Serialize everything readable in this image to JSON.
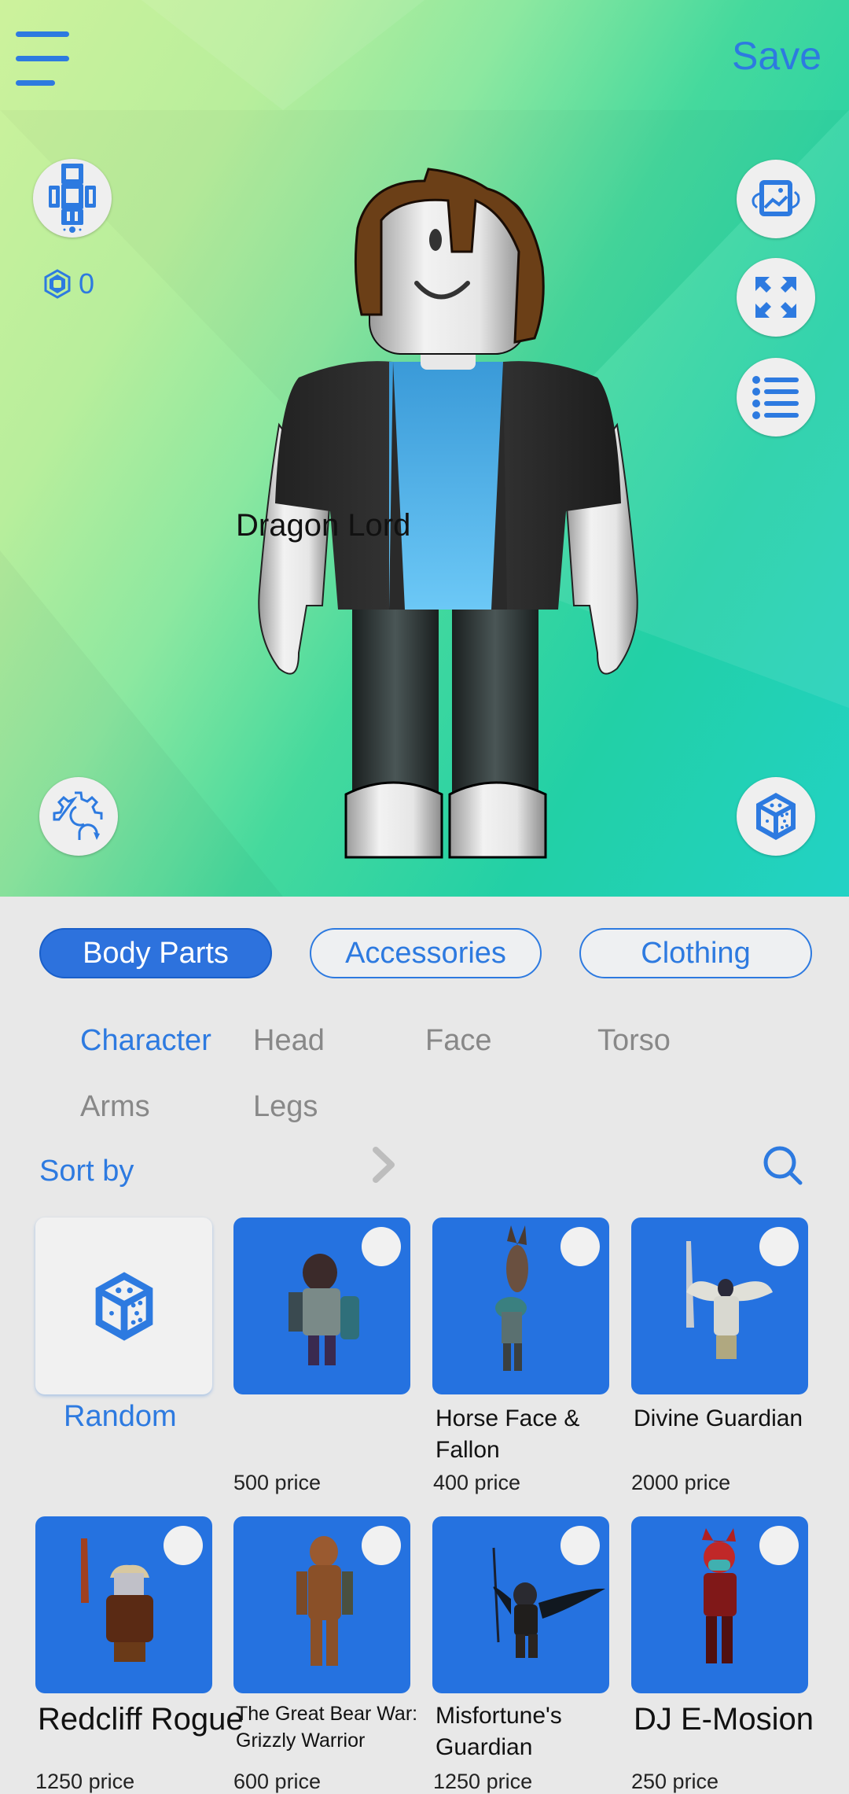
{
  "header": {
    "save_label": "Save"
  },
  "currency": {
    "amount": "0",
    "icon": "robux-icon"
  },
  "viewport_buttons": {
    "left": [
      "avatar-body-icon",
      "settings-refresh-icon"
    ],
    "right": [
      "rotate-image-icon",
      "fullscreen-icon",
      "list-icon",
      "dice-icon"
    ]
  },
  "colors": {
    "accent": "#2d7ae0",
    "card_bg": "#2572e0",
    "panel_bg": "#e8e8e8"
  },
  "tabs": [
    {
      "label": "Body Parts",
      "active": true
    },
    {
      "label": "Accessories",
      "active": false
    },
    {
      "label": "Clothing",
      "active": false
    }
  ],
  "subcategories": [
    {
      "label": "Character",
      "active": true
    },
    {
      "label": "Head",
      "active": false
    },
    {
      "label": "Face",
      "active": false
    },
    {
      "label": "Torso",
      "active": false
    },
    {
      "label": "Arms",
      "active": false
    },
    {
      "label": "Legs",
      "active": false
    }
  ],
  "sort": {
    "label": "Sort by"
  },
  "random_card": {
    "label": "Random"
  },
  "items": [
    {
      "name": "Dragon Lord",
      "price": "500 price"
    },
    {
      "name": "Horse Face & Fallon",
      "price": "400 price"
    },
    {
      "name": "Divine Guardian",
      "price": "2000 price"
    },
    {
      "name": "Redcliff Rogue",
      "price": "1250 price"
    },
    {
      "name": "The Great Bear War: Grizzly Warrior",
      "price": "600 price"
    },
    {
      "name": "Misfortune's Guardian",
      "price": "1250 price"
    },
    {
      "name": "DJ E-Mosion",
      "price": "250 price"
    }
  ]
}
